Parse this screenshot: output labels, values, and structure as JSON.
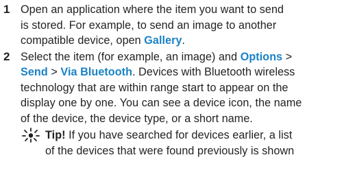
{
  "steps": [
    {
      "number": "1",
      "lines": [
        {
          "parts": [
            {
              "t": "Open an application where the item you want to send"
            }
          ]
        },
        {
          "parts": [
            {
              "t": "is stored. For example, to send an image to another"
            }
          ]
        },
        {
          "parts": [
            {
              "t": "compatible device, open "
            },
            {
              "t": "Gallery",
              "hl": true
            },
            {
              "t": "."
            }
          ]
        }
      ]
    },
    {
      "number": "2",
      "lines": [
        {
          "parts": [
            {
              "t": "Select the item (for example, an image) and "
            },
            {
              "t": "Options",
              "hl": true
            },
            {
              "t": " >"
            }
          ]
        },
        {
          "parts": [
            {
              "t": "Send",
              "hl": true
            },
            {
              "t": " > "
            },
            {
              "t": "Via Bluetooth",
              "hl": true
            },
            {
              "t": ". Devices with Bluetooth wireless"
            }
          ]
        },
        {
          "parts": [
            {
              "t": "technology that are within range start to appear on the"
            }
          ]
        },
        {
          "parts": [
            {
              "t": "display one by one. You can see a device icon, the name"
            }
          ]
        },
        {
          "parts": [
            {
              "t": "of the device, the device type, or a short name."
            }
          ]
        }
      ]
    }
  ],
  "tip": {
    "icon": "sun-bulb-icon",
    "title": "Tip!",
    "lines": [
      " If you have searched for devices earlier, a list",
      "of the devices that were found previously is shown"
    ]
  },
  "colors": {
    "text": "#231f20",
    "highlight": "#1b82c6"
  }
}
